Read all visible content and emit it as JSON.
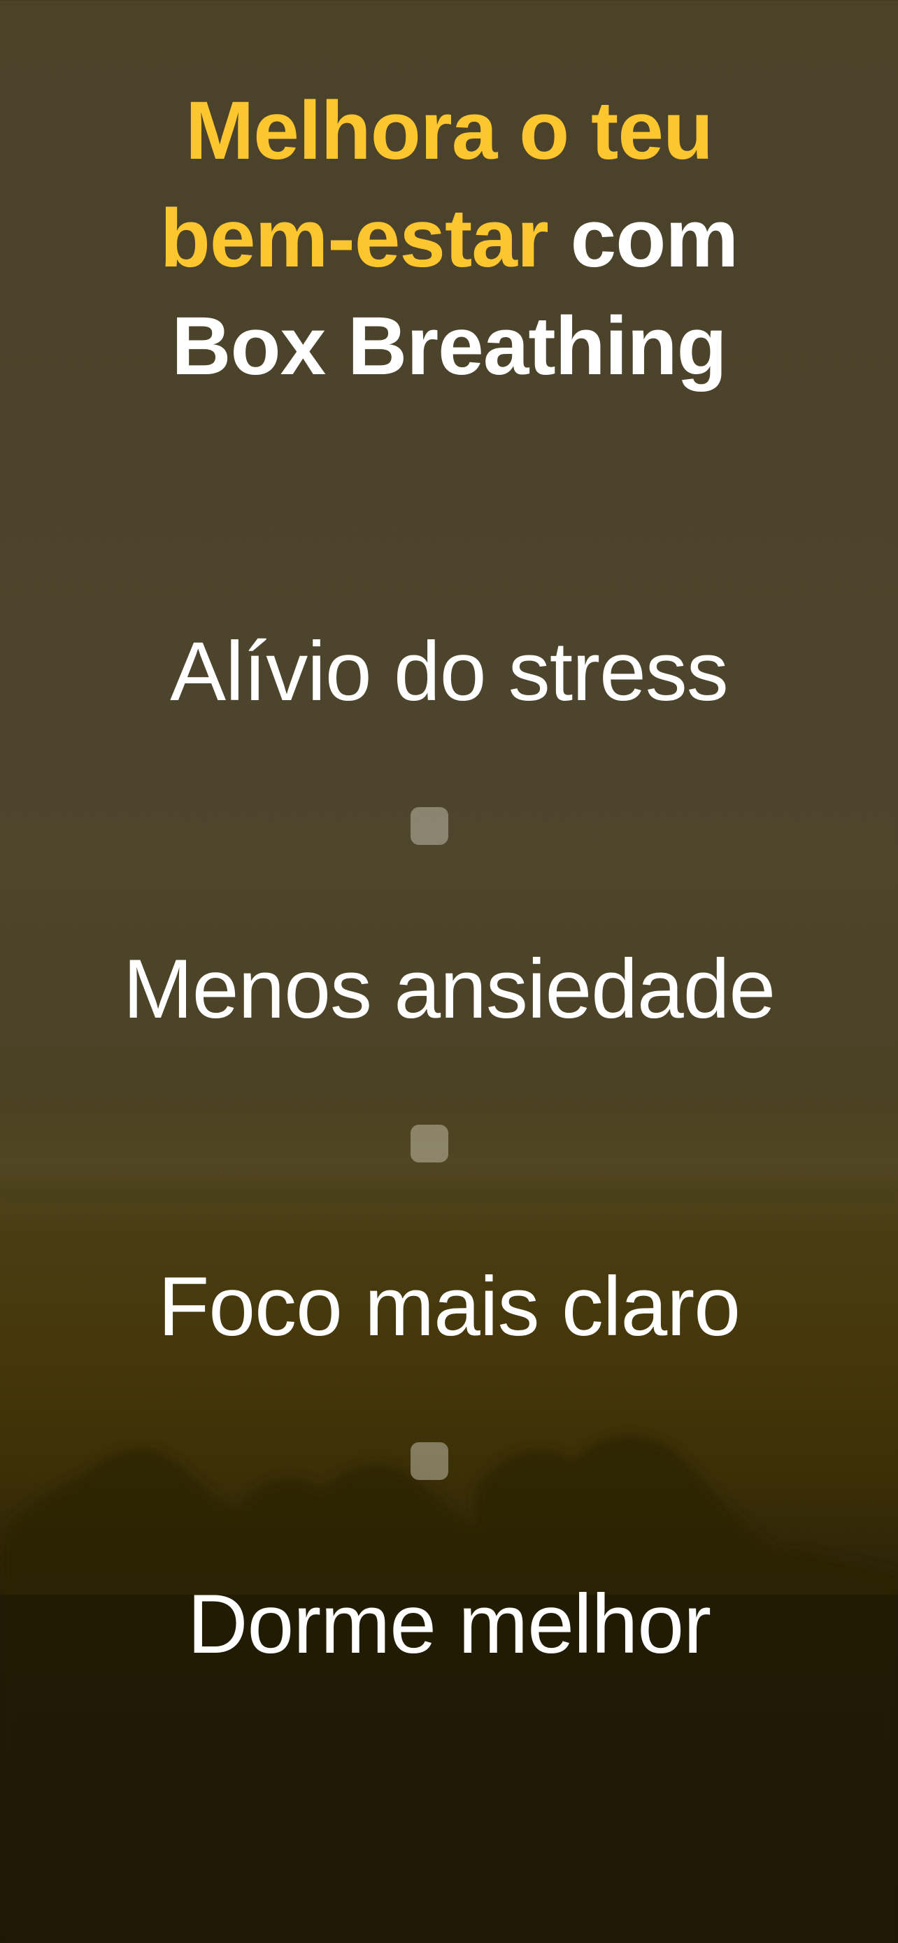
{
  "header": {
    "title_line1": "Melhora o teu",
    "title_line2_accent": "bem-estar",
    "title_line2_rest": " com",
    "title_line3": "Box Breathing"
  },
  "benefits": [
    {
      "label": "Alívio do stress"
    },
    {
      "label": "Menos ansiedade"
    },
    {
      "label": "Foco mais claro"
    },
    {
      "label": "Dorme melhor"
    }
  ],
  "colors": {
    "accent": "#fcc62f",
    "text": "#ffffff",
    "separator": "#bebaa5"
  }
}
